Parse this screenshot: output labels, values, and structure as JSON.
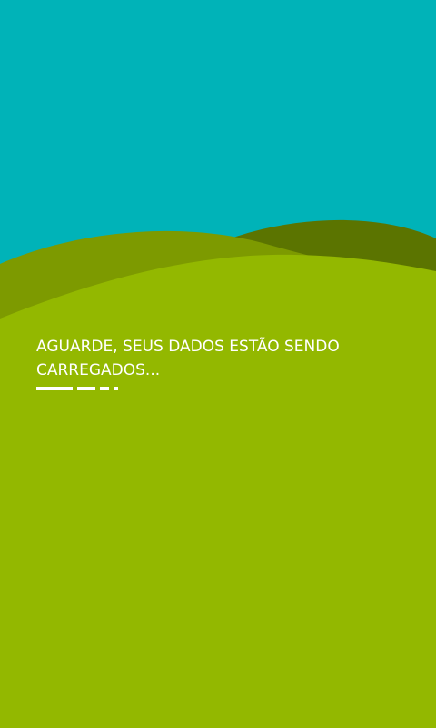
{
  "loading": {
    "message": "AGUARDE, SEUS DADOS ESTÃO SENDO CARREGADOS..."
  },
  "colors": {
    "sky": "#00b3b8",
    "hill_back": "#5b7400",
    "hill_mid": "#7d9a00",
    "ground": "#93b800",
    "text": "#ffffff"
  },
  "icons": {
    "progress_indicator": "dashed-progress-icon"
  }
}
